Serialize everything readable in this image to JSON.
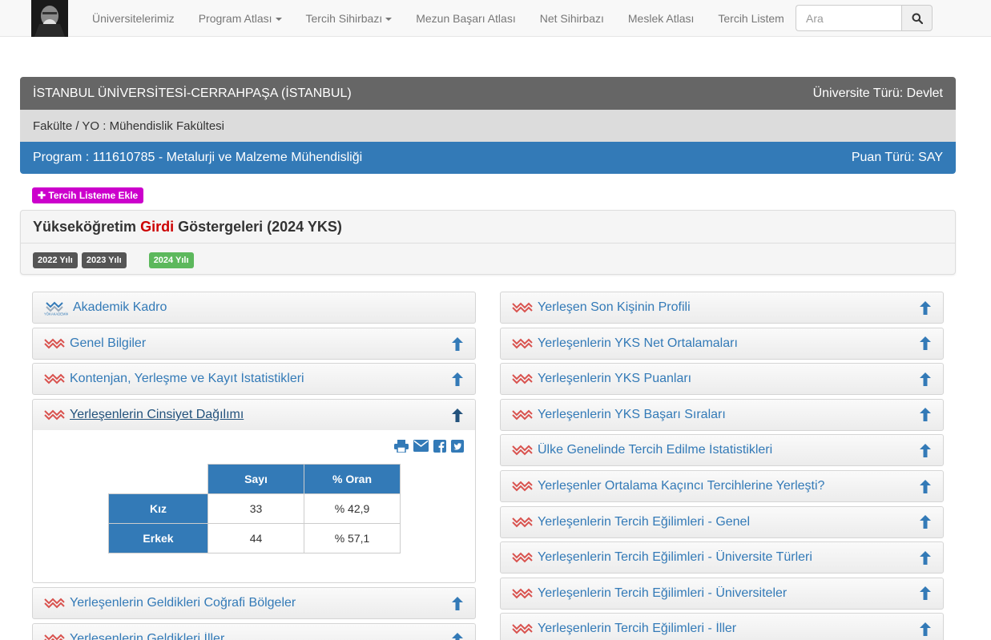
{
  "nav": {
    "logo_alt": "logo",
    "items": [
      {
        "label": "Üniversitelerimiz",
        "dropdown": false
      },
      {
        "label": "Program Atlası",
        "dropdown": true
      },
      {
        "label": "Tercih Sihirbazı",
        "dropdown": true
      },
      {
        "label": "Mezun Başarı Atlası",
        "dropdown": false
      },
      {
        "label": "Net Sihirbazı",
        "dropdown": false
      },
      {
        "label": "Meslek Atlası",
        "dropdown": false
      },
      {
        "label": "Tercih Listem",
        "dropdown": false
      }
    ],
    "search_placeholder": "Ara",
    "search_icon": "search-icon"
  },
  "university": {
    "name": "İSTANBUL ÜNİVERSİTESİ-CERRAHPAŞA (İSTANBUL)",
    "type": "Üniversite Türü: Devlet"
  },
  "faculty": "Fakülte / YO : Mühendislik Fakültesi",
  "program": {
    "label": "Program : 111610785 - Metalurji ve Malzeme Mühendisliği",
    "score_type": "Puan Türü: SAY"
  },
  "add_button": "✚ Tercih Listeme Ekle",
  "indicators": {
    "title_pre": "Yükseköğretim",
    "title_highlight": "Girdi",
    "title_post": "Göstergeleri (2024 YKS)",
    "years": [
      "2022 Yılı",
      "2023 Yılı",
      "2024 Yılı"
    ],
    "active_year": "2024 Yılı"
  },
  "left_sections": [
    {
      "label": "Akademik Kadro",
      "icon": "yokakademik-icon",
      "arrow": false
    },
    {
      "label": "Genel Bilgiler",
      "icon": "yok-logo-icon",
      "arrow": true
    },
    {
      "label": "Kontenjan, Yerleşme ve Kayıt İstatistikleri",
      "icon": "yok-logo-icon",
      "arrow": true
    },
    {
      "label": "Yerleşenlerin Cinsiyet Dağılımı",
      "icon": "yok-logo-icon",
      "arrow": true,
      "open": true
    },
    {
      "label": "Yerleşenlerin Geldikleri Coğrafi Bölgeler",
      "icon": "yok-logo-icon",
      "arrow": true
    },
    {
      "label": "Yerleşenlerin Geldikleri İller",
      "icon": "yok-logo-icon",
      "arrow": true
    }
  ],
  "yokakademik_text": "YÖKAKADEMİK",
  "gender_table": {
    "headers": [
      "Sayı",
      "% Oran"
    ],
    "rows": [
      {
        "label": "Kız",
        "count": "33",
        "ratio": "% 42,9"
      },
      {
        "label": "Erkek",
        "count": "44",
        "ratio": "% 57,1"
      }
    ]
  },
  "right_sections": [
    {
      "label": "Yerleşen Son Kişinin Profili"
    },
    {
      "label": "Yerleşenlerin YKS Net Ortalamaları"
    },
    {
      "label": "Yerleşenlerin YKS Puanları"
    },
    {
      "label": "Yerleşenlerin YKS Başarı Sıraları"
    },
    {
      "label": "Ülke Genelinde Tercih Edilme İstatistikleri"
    },
    {
      "label": "Yerleşenler Ortalama Kaçıncı Tercihlerine Yerleşti?"
    },
    {
      "label": "Yerleşenlerin Tercih Eğilimleri - Genel"
    },
    {
      "label": "Yerleşenlerin Tercih Eğilimleri - Üniversite Türleri"
    },
    {
      "label": "Yerleşenlerin Tercih Eğilimleri - Üniversiteler"
    },
    {
      "label": "Yerleşenlerin Tercih Eğilimleri - İller"
    }
  ],
  "colors": {
    "primary": "#337ab7",
    "accent_red": "#cc0000",
    "add_button": "#cc00cc",
    "active_year": "#5cb85c"
  }
}
